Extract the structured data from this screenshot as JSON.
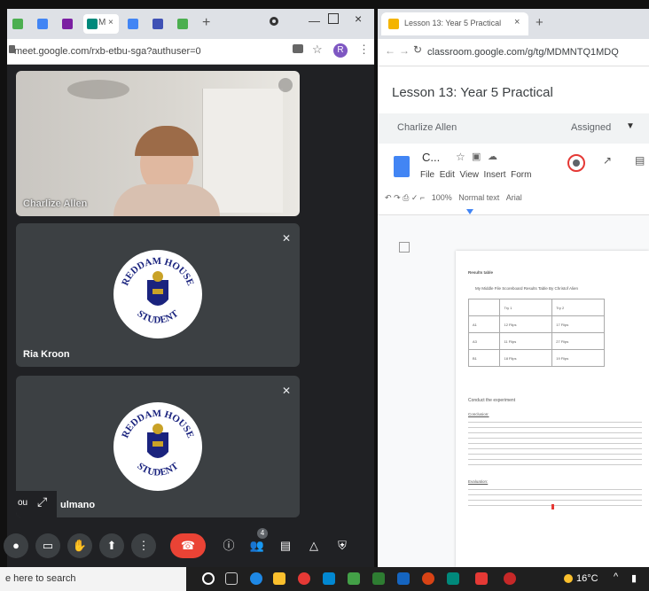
{
  "left_window": {
    "tabs": [
      "M",
      "×"
    ],
    "address": "meet.google.com/rxb-etbu-sga?authuser=0",
    "profile_initial": "R",
    "participants": [
      {
        "name": "Charlize Allen",
        "type": "video"
      },
      {
        "name": "Ria Kroon",
        "type": "badge",
        "muted": true
      },
      {
        "name": "ulmano",
        "type": "badge",
        "muted": true
      }
    ],
    "badge": {
      "top": "REDDAM HOUSE",
      "bottom": "STUDENT"
    },
    "partial_label": "ou",
    "people_count": "4"
  },
  "right_window": {
    "tab_title": "Lesson 13: Year 5 Practical",
    "address": "classroom.google.com/g/tg/MDMNTQ1MDQ",
    "lesson_title": "Lesson 13: Year 5 Practical",
    "student": "Charlize Allen",
    "status": "Assigned",
    "doc": {
      "title": "C...",
      "menus": [
        "File",
        "Edit",
        "View",
        "Insert",
        "Form"
      ],
      "zoom": "100%",
      "style": "Normal text",
      "font": "Arial",
      "heading": "Results table",
      "table_title": "My Middle File Scoreboard Results Table By Christof Alien",
      "table_head": [
        "",
        "Try 1",
        "Try 2"
      ],
      "table_rows": [
        [
          "A1",
          "12 Flips",
          "17 Flips"
        ],
        [
          "A3",
          "11 Flips",
          "27 Flips"
        ],
        [
          "B1",
          "18 Flips",
          "19 Flips"
        ]
      ],
      "section": "Conduct the experiment",
      "subhead1": "Conclusion:",
      "subhead2": "Evaluation:"
    }
  },
  "taskbar": {
    "search_placeholder": "e here to search",
    "temperature": "16°C"
  },
  "colors": {
    "meet_bg": "#202124",
    "end_call": "#ea4335",
    "docs_blue": "#4285f4"
  }
}
